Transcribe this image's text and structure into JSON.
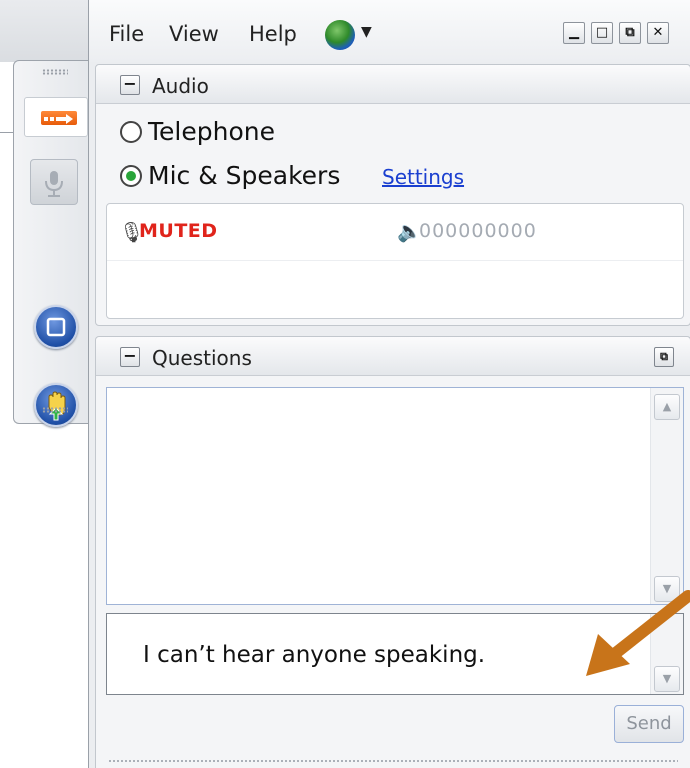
{
  "menu": {
    "file": "File",
    "view": "View",
    "help": "Help"
  },
  "window_controls": {
    "minimize": "▁",
    "maximize": "□",
    "restore": "⧉",
    "close": "✕"
  },
  "audio_panel": {
    "title": "Audio",
    "collapse": "−",
    "options": [
      {
        "label": "Telephone",
        "selected": false
      },
      {
        "label": "Mic & Speakers",
        "selected": true
      }
    ],
    "settings_link": "Settings",
    "mic_status": "MUTED",
    "speaker_level": "000000000"
  },
  "questions_panel": {
    "title": "Questions",
    "collapse": "−",
    "input_value": "I can’t hear anyone speaking.",
    "send_label": "Send"
  },
  "icons": {
    "toolbar": [
      "arrow-icon",
      "microphone-icon",
      "stop-icon",
      "raise-hand-icon"
    ],
    "menu": [
      "globe-icon",
      "caret-down-icon"
    ]
  },
  "colors": {
    "muted_red": "#e0241b",
    "link_blue": "#1a3fd0",
    "radio_green": "#2aa53a",
    "toolbar_orange": "#e75b0a",
    "annotation_arrow": "#c8741a"
  }
}
